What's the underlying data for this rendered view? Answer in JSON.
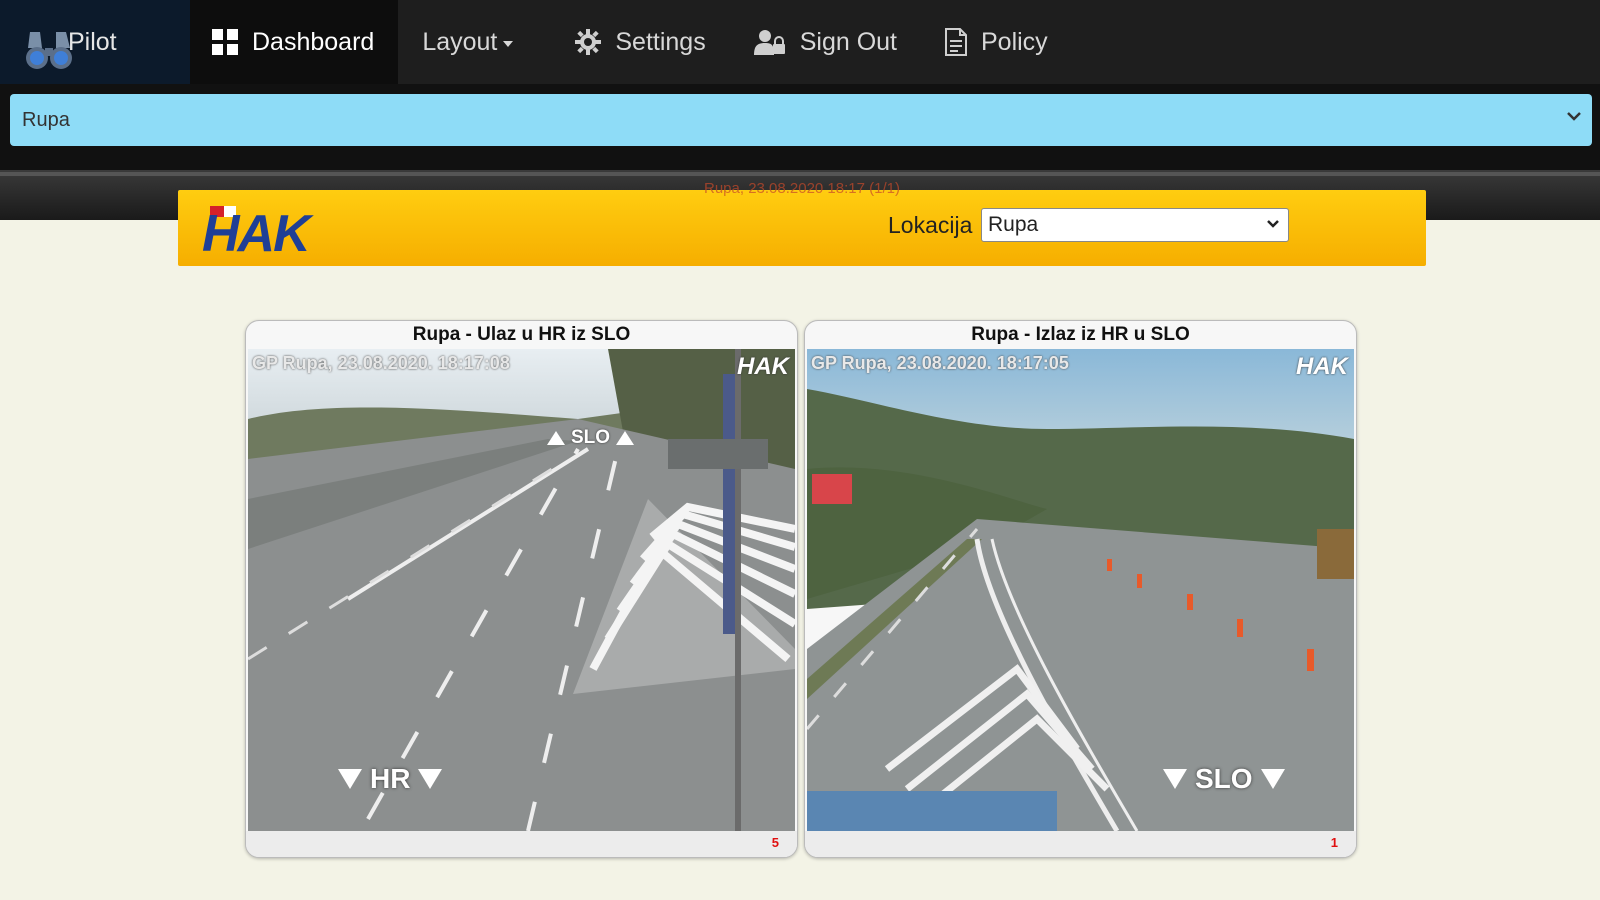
{
  "nav": {
    "brand_label": "Pilot",
    "dashboard": "Dashboard",
    "layout": "Layout",
    "settings": "Settings",
    "sign_out": "Sign Out",
    "policy": "Policy"
  },
  "location_select": {
    "selected": "Rupa"
  },
  "hak": {
    "ghost_text": "Rupa, 23.08.2020 18:17 (1/1)",
    "logo_text": "HAK",
    "location_label": "Lokacija",
    "location_value": "Rupa"
  },
  "cameras": [
    {
      "title": "Rupa - Ulaz u HR iz SLO",
      "timestamp": "GP Rupa, 23.08.2020. 18:17:08",
      "watermark": "HAK",
      "sign_top": "SLO",
      "sign_bottom": "HR",
      "counter": "5"
    },
    {
      "title": "Rupa - Izlaz iz HR u SLO",
      "timestamp": "GP Rupa, 23.08.2020. 18:17:05",
      "watermark": "HAK",
      "sign_bottom": "SLO",
      "counter": "1"
    }
  ],
  "colors": {
    "nav_bg": "#1e1e1e",
    "brand_bg": "#0c1a2b",
    "select_bg": "#8edcf7",
    "hak_yellow": "#ffc20e",
    "hak_blue": "#1f3f95",
    "hak_red": "#d4202a",
    "page_bg": "#f3f3e6"
  }
}
